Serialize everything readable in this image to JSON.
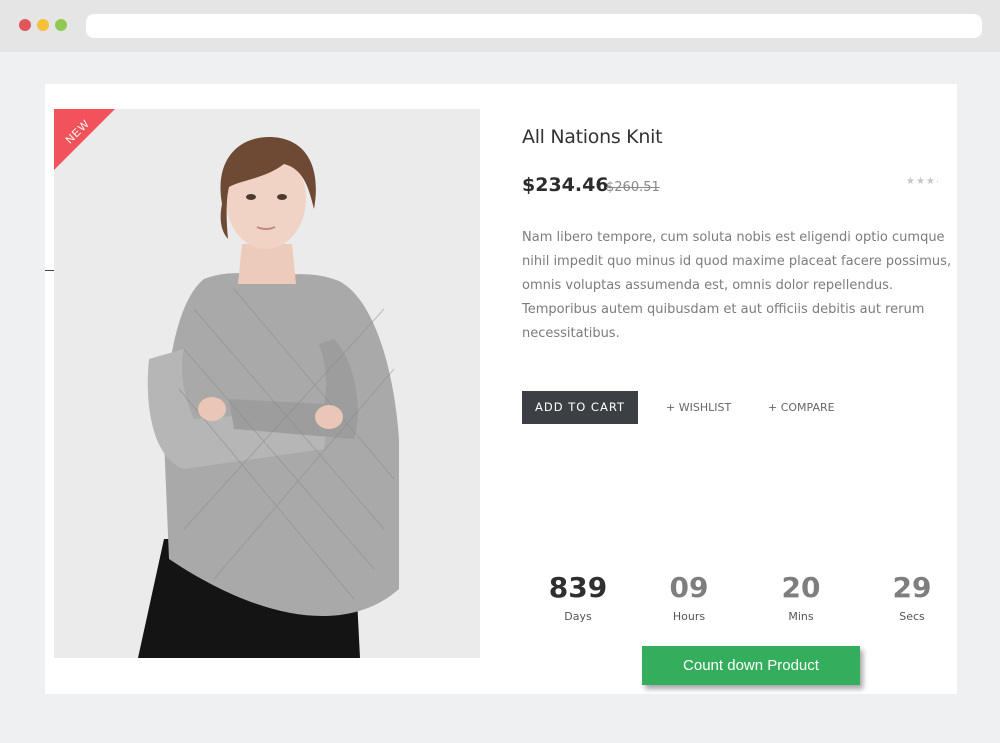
{
  "browser": {
    "url": ""
  },
  "product": {
    "badge": "NEW",
    "title": "All Nations Knit",
    "price": "$234.46",
    "old_price": "$260.51",
    "rating_stars": "★★★·",
    "description": "Nam libero tempore, cum soluta nobis est eligendi optio cumque nihil impedit quo minus id quod maxime placeat facere possimus, omnis voluptas assumenda est, omnis dolor repellendus. Temporibus autem quibusdam et aut officiis debitis aut rerum necessitatibus."
  },
  "actions": {
    "add_to_cart": "ADD TO CART",
    "wishlist": "+ WISHLIST",
    "compare": "+ COMPARE"
  },
  "countdown": {
    "days": "839",
    "days_label": "Days",
    "hours": "09",
    "hours_label": "Hours",
    "mins": "20",
    "mins_label": "Mins",
    "secs": "29",
    "secs_label": "Secs"
  },
  "countdown_button": "Count down Product",
  "colors": {
    "badge": "#f2525a",
    "cart_button": "#3c3f43",
    "countdown_button": "#34ad5c"
  }
}
